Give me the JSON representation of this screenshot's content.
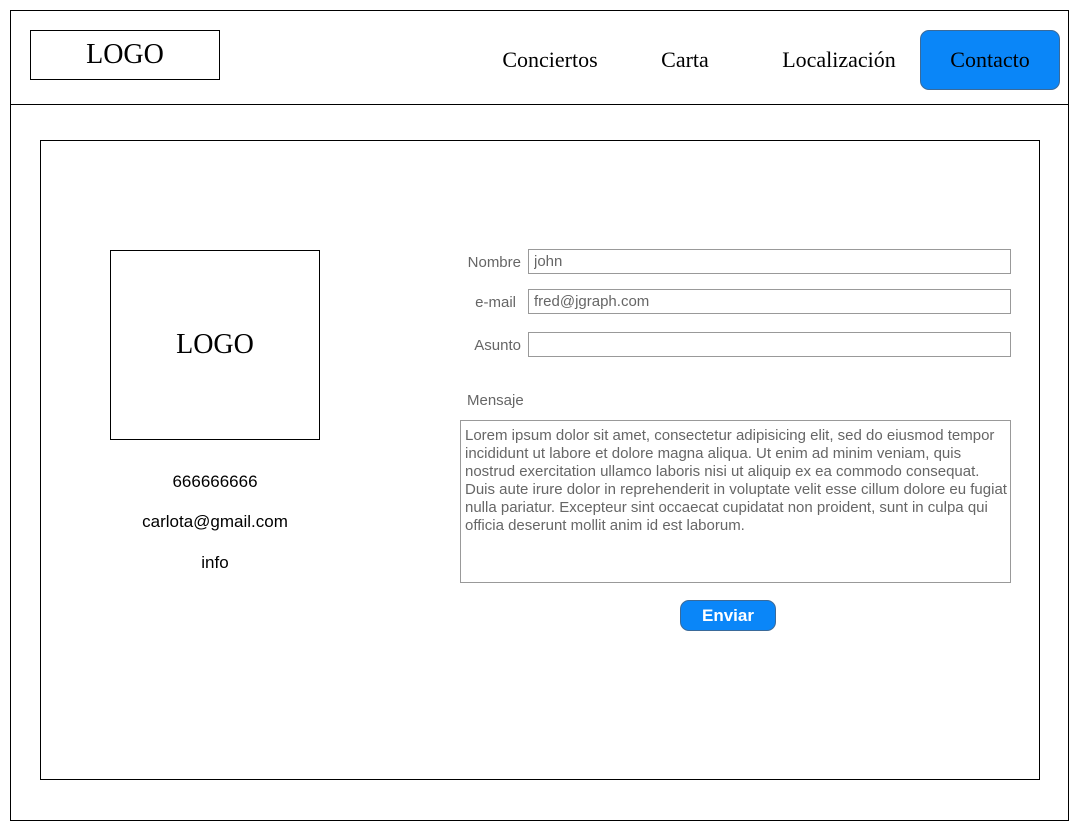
{
  "header": {
    "logo": "LOGO",
    "nav": [
      {
        "label": "Conciertos",
        "active": false
      },
      {
        "label": "Carta",
        "active": false
      },
      {
        "label": "Localización",
        "active": false
      },
      {
        "label": "Contacto",
        "active": true
      }
    ]
  },
  "sidebar": {
    "logo": "LOGO",
    "phone": "666666666",
    "email": "carlota@gmail.com",
    "info": "info"
  },
  "form": {
    "nombre_label": "Nombre",
    "nombre_value": "john",
    "email_label": "e-mail",
    "email_value": "fred@jgraph.com",
    "asunto_label": "Asunto",
    "asunto_value": "",
    "mensaje_label": "Mensaje",
    "mensaje_value": "Lorem ipsum dolor sit amet, consectetur adipisicing elit, sed do eiusmod tempor incididunt ut labore et dolore magna aliqua. Ut enim ad minim veniam, quis nostrud exercitation ullamco laboris nisi ut aliquip ex ea commodo consequat. Duis aute irure dolor in reprehenderit in voluptate velit esse cillum dolore eu fugiat nulla pariatur. Excepteur sint occaecat cupidatat non proident, sunt in culpa qui officia deserunt mollit anim id est laborum.",
    "submit_label": "Enviar"
  },
  "colors": {
    "accent": "#0a86f8"
  }
}
